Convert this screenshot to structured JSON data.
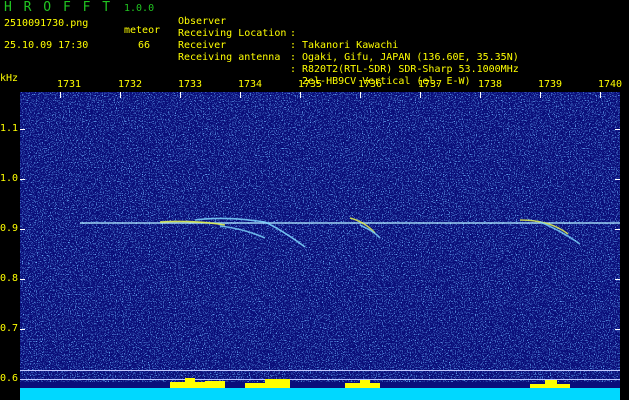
{
  "header": {
    "app_title": "H R O F F T",
    "app_version": "1.0.0",
    "file_name": "2510091730.png",
    "date_time": "25.10.09 17:30",
    "type_label": "meteor",
    "count": "66"
  },
  "info": [
    {
      "key": "Observer",
      "colon": ":",
      "value": "Takanori Kawachi"
    },
    {
      "key": "Receiving Location",
      "colon": ":",
      "value": "Ogaki, Gifu, JAPAN (136.60E, 35.35N)"
    },
    {
      "key": "Receiver",
      "colon": ":",
      "value": "R820T2(RTL-SDR) SDR-Sharp 53.1000MHz"
    },
    {
      "key": "Receiving antenna",
      "colon": ":",
      "value": "2el-HB9CV Vertical (el. E-W)"
    }
  ],
  "axis": {
    "y_unit": "kHz",
    "x_ticks": [
      "1731",
      "1732",
      "1733",
      "1734",
      "1735",
      "1736",
      "1737",
      "1738",
      "1739",
      "1740"
    ],
    "y_ticks": [
      "1.1",
      "1.0",
      "0.9",
      "0.8",
      "0.7",
      "0.6"
    ]
  },
  "colors": {
    "background": "#000000",
    "text_yellow": "#ffff00",
    "title_green": "#21c421",
    "spectrogram_bg": "#0a0e7a",
    "tick_white": "#ffffff",
    "carrier_cyan": "#aee8ff",
    "bottom_band_cyan": "#00d8ff",
    "bottom_band_yellow": "#ffff00"
  }
}
